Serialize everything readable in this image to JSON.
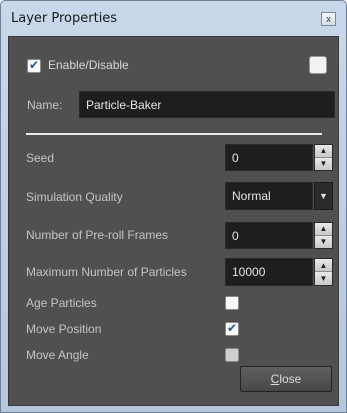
{
  "window": {
    "title": "Layer Properties",
    "close_glyph": "x"
  },
  "enable": {
    "label": "Enable/Disable",
    "checked": true
  },
  "color_swatch": {
    "color": "#f2f2f2"
  },
  "name": {
    "label": "Name:",
    "value": "Particle-Baker"
  },
  "seed": {
    "label": "Seed",
    "value": "0"
  },
  "quality": {
    "label": "Simulation Quality",
    "value": "Normal"
  },
  "preroll": {
    "label": "Number of Pre-roll Frames",
    "value": "0"
  },
  "max_particles": {
    "label": "Maximum Number of Particles",
    "value": "10000"
  },
  "age_particles": {
    "label": "Age Particles",
    "checked": false
  },
  "move_position": {
    "label": "Move Position",
    "checked": true
  },
  "move_angle": {
    "label": "Move Angle",
    "checked": false,
    "disabled": true
  },
  "buttons": {
    "close_first": "C",
    "close_rest": "lose"
  },
  "icons": {
    "spin_up": "▲",
    "spin_down": "▼",
    "dropdown": "▼"
  }
}
